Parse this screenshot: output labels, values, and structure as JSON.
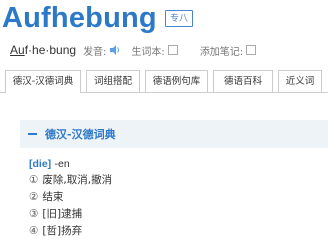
{
  "header": {
    "headword": "Aufhebung",
    "level_badge": "专八"
  },
  "pronunciation": {
    "syllable_first": "Au",
    "syllable_rest": "f·he·bung",
    "pron_label": "发音:",
    "vocab_label": "生词本:",
    "note_label": "添加笔记:"
  },
  "tabs": [
    {
      "label": "德汉-汉德词典"
    },
    {
      "label": "词组搭配"
    },
    {
      "label": "德语例句库"
    },
    {
      "label": "德语百科"
    },
    {
      "label": "近义词"
    }
  ],
  "section": {
    "title": "德汉-汉德词典"
  },
  "entry": {
    "gender": "[die]",
    "plural": "-en",
    "senses": [
      {
        "num": "①",
        "text": "废除,取消,撤消"
      },
      {
        "num": "②",
        "text": "结束"
      },
      {
        "num": "③",
        "text": "[旧]逮捕"
      },
      {
        "num": "④",
        "text": "[哲]扬弃"
      }
    ]
  },
  "colors": {
    "accent": "#2c78c9",
    "section_bg": "#eef3f8"
  }
}
